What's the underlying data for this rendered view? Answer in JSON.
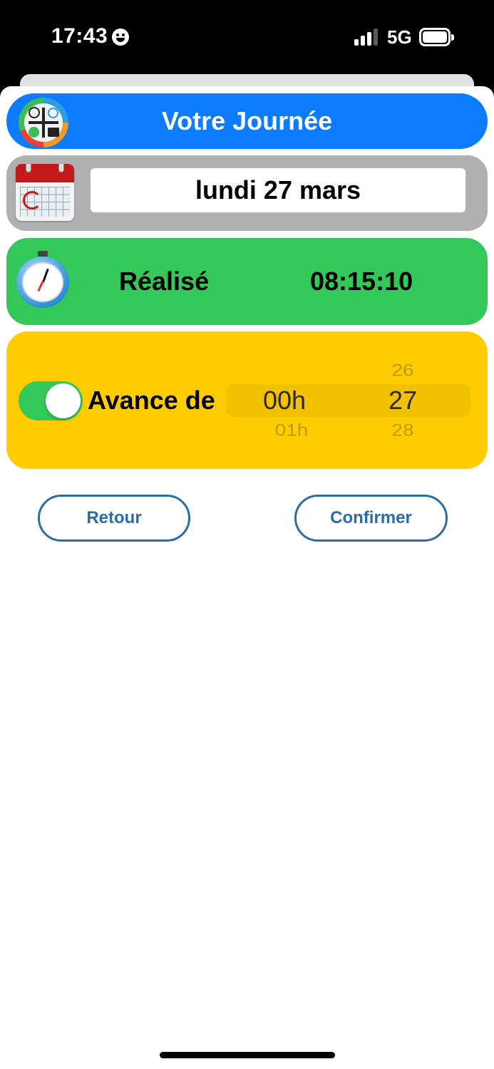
{
  "status_bar": {
    "time": "17:43",
    "network": "5G",
    "icons": [
      "smiley-icon",
      "signal-icon",
      "battery-icon"
    ]
  },
  "header": {
    "title": "Votre Journée",
    "logo": "app-logo-icon",
    "color": "#0c7bff"
  },
  "date_row": {
    "icon": "calendar-icon",
    "value": "lundi 27 mars",
    "color": "#b0b0b2"
  },
  "realise_row": {
    "icon": "stopwatch-icon",
    "label": "Réalisé",
    "value": "08:15:10",
    "color": "#34c759"
  },
  "avance_row": {
    "toggle_on": true,
    "label": "Avance de",
    "color": "#ffcc00",
    "picker": {
      "hours": {
        "selected": "00h",
        "next": "01h"
      },
      "minutes": {
        "prev": "26",
        "selected": "27",
        "next": "28"
      }
    }
  },
  "actions": {
    "back_label": "Retour",
    "confirm_label": "Confirmer",
    "accent": "#2b6ea6"
  }
}
